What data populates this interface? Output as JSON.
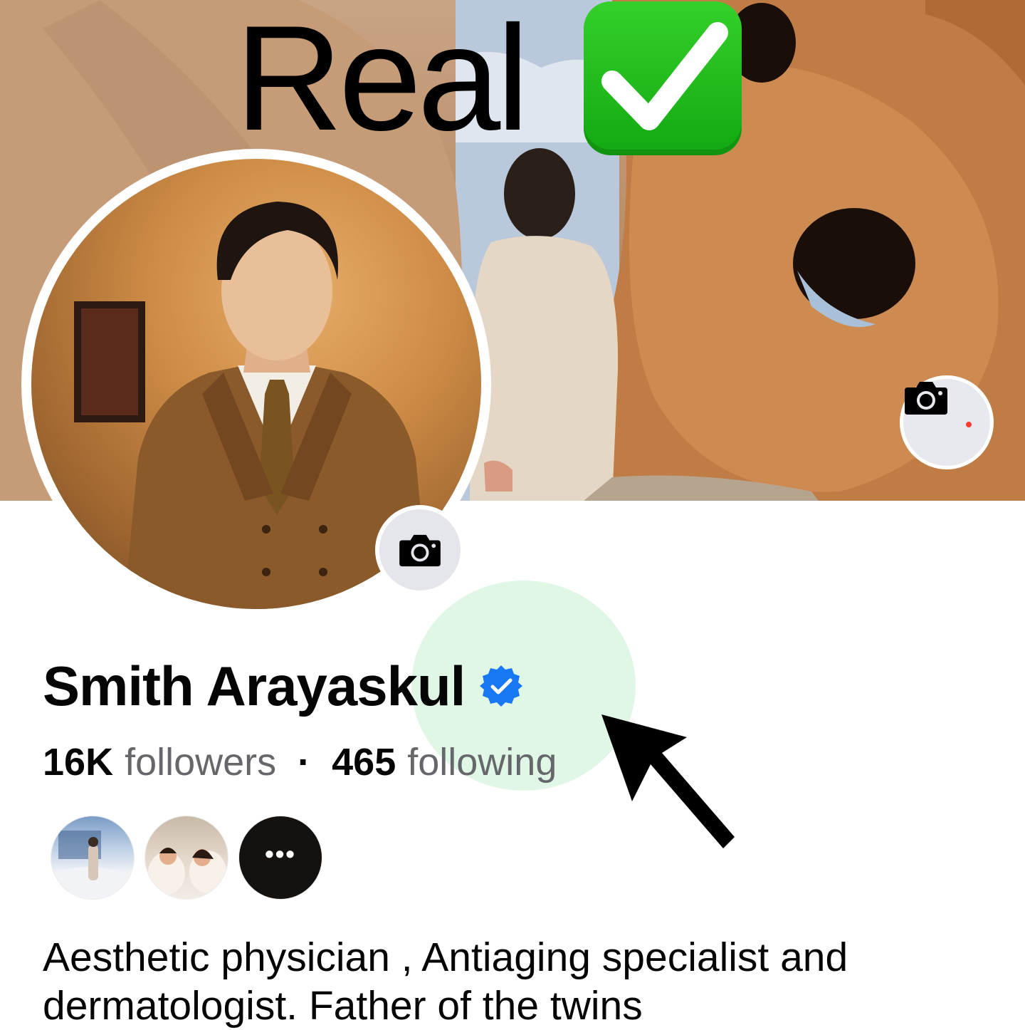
{
  "overlay": {
    "caption": "Real",
    "emoji": "white-check-mark-emoji",
    "emoji_color": "#1fbd1a"
  },
  "cover": {
    "camera_icon": "camera-icon",
    "notification_dot_color": "#ff3b30"
  },
  "profile": {
    "avatar_camera_icon": "camera-icon",
    "name": "Smith Arayaskul",
    "verified_icon": "verified-badge-icon",
    "verified_color": "#1877f2",
    "highlight_color": "#cfeed8"
  },
  "stats": {
    "followers_count": "16K",
    "followers_label": "followers",
    "separator": "·",
    "following_count": "465",
    "following_label": "following"
  },
  "annotation": {
    "arrow_icon": "arrow-pointer-icon"
  },
  "friends": {
    "more_label": "•••"
  },
  "bio": {
    "text": "Aesthetic physician , Antiaging specialist and dermatologist. Father of the twins"
  }
}
